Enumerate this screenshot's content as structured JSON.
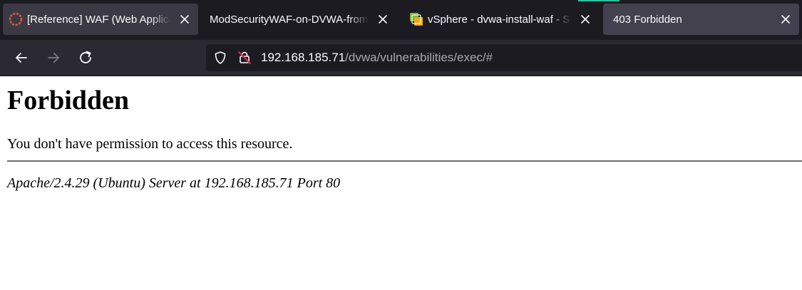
{
  "tabs": [
    {
      "title": "[Reference] WAF (Web Applica",
      "favicon": "red-ring-icon",
      "state": "hover"
    },
    {
      "title": "ModSecurityWAF-on-DVWA-from-to",
      "favicon": null,
      "state": "inactive"
    },
    {
      "title": "vSphere - dvwa-install-waf - Sum",
      "favicon": "vsphere-icon",
      "state": "inactive"
    },
    {
      "title": "403 Forbidden",
      "favicon": null,
      "state": "active"
    }
  ],
  "nav": {
    "back_icon": "back-arrow-icon",
    "forward_icon": "forward-arrow-icon",
    "reload_icon": "reload-icon"
  },
  "address_bar": {
    "host": "192.168.185.71",
    "path": "/dvwa/vulnerabilities/exec/#",
    "tracking_icon": "shield-icon",
    "security_icon": "insecure-lock-icon"
  },
  "page": {
    "heading": "Forbidden",
    "message": "You don't have permission to access this resource.",
    "server_signature": "Apache/2.4.29 (Ubuntu) Server at 192.168.185.71 Port 80"
  },
  "colors": {
    "tabstrip_bg": "#1c1b22",
    "navbar_bg": "#2b2a33",
    "active_tab_bg": "#42414d",
    "accent": "#2ac3a2"
  }
}
